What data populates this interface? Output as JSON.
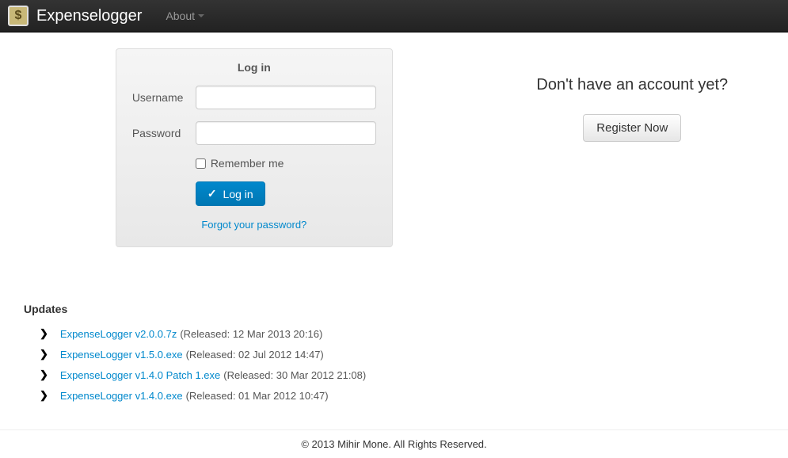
{
  "navbar": {
    "brand": "Expenselogger",
    "about": "About"
  },
  "login": {
    "title": "Log in",
    "username_label": "Username",
    "password_label": "Password",
    "remember_label": "Remember me",
    "submit_label": "Log in",
    "forgot_label": "Forgot your password?"
  },
  "register": {
    "heading": "Don't have an account yet?",
    "button": "Register Now"
  },
  "updates": {
    "title": "Updates",
    "items": [
      {
        "name": "ExpenseLogger v2.0.0.7z",
        "meta": "(Released: 12 Mar 2013 20:16)"
      },
      {
        "name": "ExpenseLogger v1.5.0.exe",
        "meta": "(Released: 02 Jul 2012 14:47)"
      },
      {
        "name": "ExpenseLogger v1.4.0 Patch 1.exe",
        "meta": "(Released: 30 Mar 2012 21:08)"
      },
      {
        "name": "ExpenseLogger v1.4.0.exe",
        "meta": "(Released: 01 Mar 2012 10:47)"
      }
    ]
  },
  "footer": {
    "text": "© 2013 Mihir Mone. All Rights Reserved."
  }
}
